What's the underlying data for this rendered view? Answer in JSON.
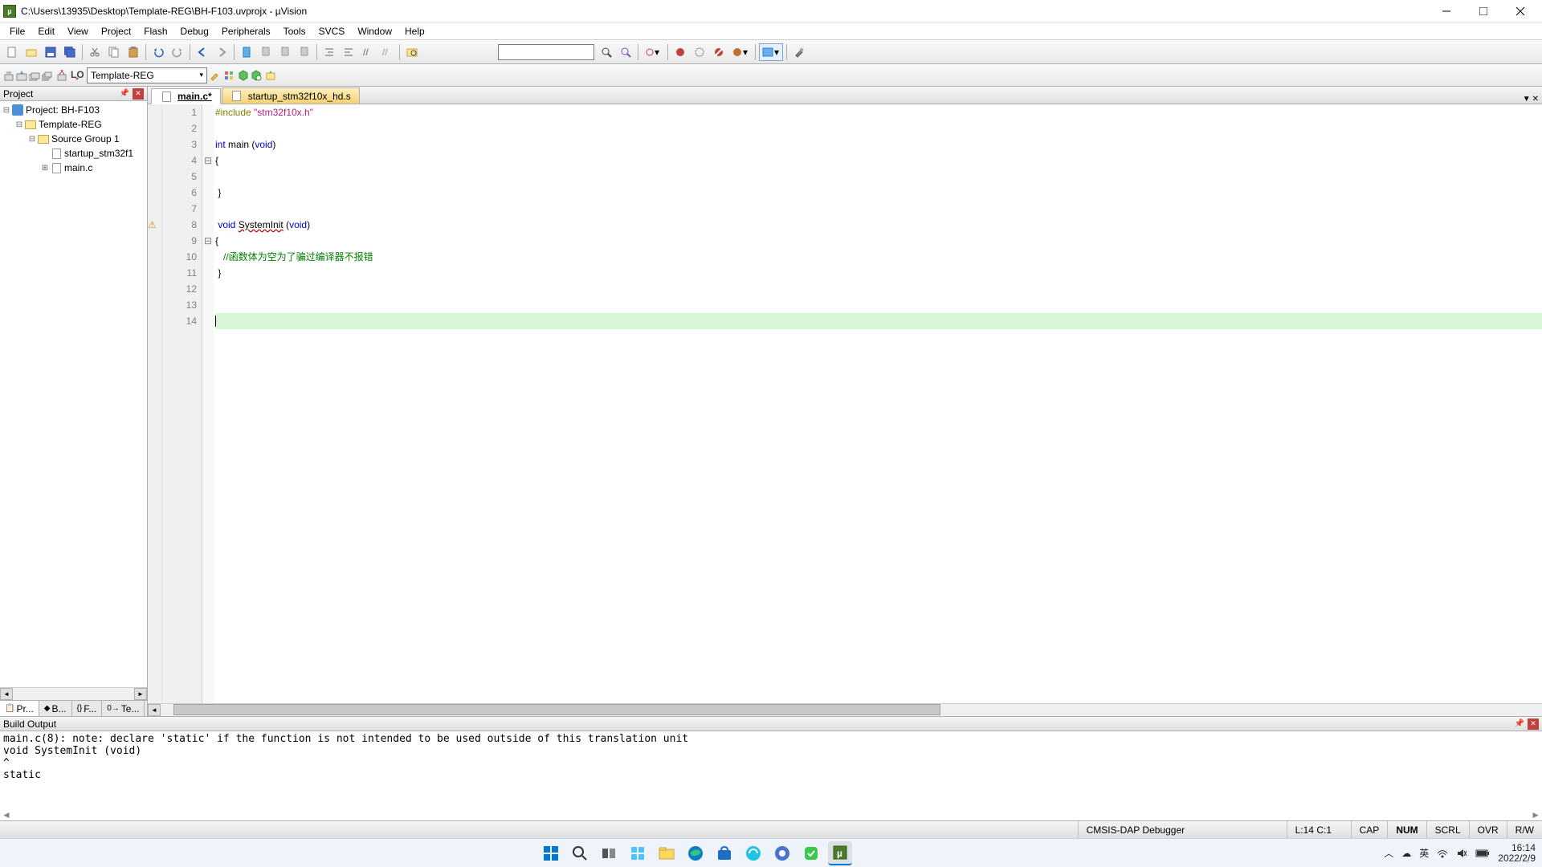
{
  "window": {
    "title": "C:\\Users\\13935\\Desktop\\Template-REG\\BH-F103.uvprojx - µVision"
  },
  "menu": {
    "items": [
      "File",
      "Edit",
      "View",
      "Project",
      "Flash",
      "Debug",
      "Peripherals",
      "Tools",
      "SVCS",
      "Window",
      "Help"
    ]
  },
  "toolbar2": {
    "target": "Template-REG"
  },
  "project_panel": {
    "title": "Project",
    "root": "Project: BH-F103",
    "target": "Template-REG",
    "group": "Source Group 1",
    "files": [
      "startup_stm32f1",
      "main.c"
    ],
    "tabs": [
      "Pr...",
      "B...",
      "F...",
      "Te..."
    ]
  },
  "editor": {
    "tabs": [
      {
        "label": "main.c*",
        "active": true
      },
      {
        "label": "startup_stm32f10x_hd.s",
        "active": false
      }
    ],
    "lines": [
      {
        "n": "1",
        "html": "<span class='pp'>#include</span> <span class='str'>\"stm32f10x.h\"</span>"
      },
      {
        "n": "2",
        "html": ""
      },
      {
        "n": "3",
        "html": "<span class='kw'>int</span> main (<span class='kw'>void</span>)"
      },
      {
        "n": "4",
        "html": "{",
        "fold": "⊟"
      },
      {
        "n": "5",
        "html": ""
      },
      {
        "n": "6",
        "html": " }"
      },
      {
        "n": "7",
        "html": ""
      },
      {
        "n": "8",
        "html": " <span class='kw'>void</span> <span class='wavy'>SystemInit</span> (<span class='kw'>void</span>)",
        "warn": true
      },
      {
        "n": "9",
        "html": "{",
        "fold": "⊟"
      },
      {
        "n": "10",
        "html": "   <span class='cmt'>//函数体为空为了骗过编译器不报错</span>"
      },
      {
        "n": "11",
        "html": " }"
      },
      {
        "n": "12",
        "html": ""
      },
      {
        "n": "13",
        "html": ""
      },
      {
        "n": "14",
        "html": "<span class='caret'></span>",
        "current": true
      }
    ]
  },
  "build_output": {
    "title": "Build Output",
    "text": "main.c(8): note: declare 'static' if the function is not intended to be used outside of this translation unit\nvoid SystemInit (void)\n^\nstatic"
  },
  "statusbar": {
    "debugger": "CMSIS-DAP Debugger",
    "pos": "L:14 C:1",
    "indicators": [
      "CAP",
      "NUM",
      "SCRL",
      "OVR",
      "R/W"
    ]
  },
  "taskbar": {
    "ime": "英",
    "time": "16:14",
    "date": "2022/2/9"
  }
}
